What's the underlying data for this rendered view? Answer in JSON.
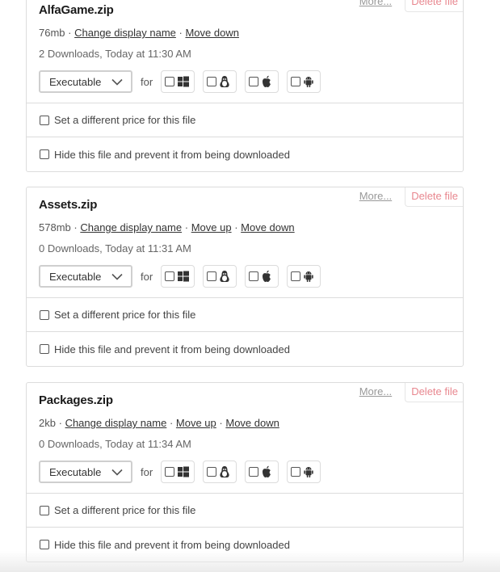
{
  "common": {
    "more_label": "More...",
    "delete_label": "Delete file",
    "for_label": "for",
    "separator": "·",
    "change_name_label": "Change display name",
    "move_up_label": "Move up",
    "move_down_label": "Move down",
    "price_option_label": "Set a different price for this file",
    "hide_option_label": "Hide this file and prevent it from being downloaded",
    "platforms": [
      "windows",
      "linux",
      "apple",
      "android"
    ]
  },
  "colors": {
    "delete": "#e8878f",
    "border": "#dcdcdc",
    "link": "#333333"
  },
  "files": [
    {
      "name": "AlfaGame.zip",
      "size": "76mb",
      "downloads": "2 Downloads, Today at 11:30 AM",
      "type": "Executable",
      "can_move_up": false,
      "can_move_down": true,
      "platforms_checked": [
        false,
        false,
        false,
        false
      ],
      "price_checked": false,
      "hide_checked": false
    },
    {
      "name": "Assets.zip",
      "size": "578mb",
      "downloads": "0 Downloads, Today at 11:31 AM",
      "type": "Executable",
      "can_move_up": true,
      "can_move_down": true,
      "platforms_checked": [
        false,
        false,
        false,
        false
      ],
      "price_checked": false,
      "hide_checked": false
    },
    {
      "name": "Packages.zip",
      "size": "2kb",
      "downloads": "0 Downloads, Today at 11:34 AM",
      "type": "Executable",
      "can_move_up": true,
      "can_move_down": true,
      "platforms_checked": [
        false,
        false,
        false,
        false
      ],
      "price_checked": false,
      "hide_checked": false
    }
  ]
}
